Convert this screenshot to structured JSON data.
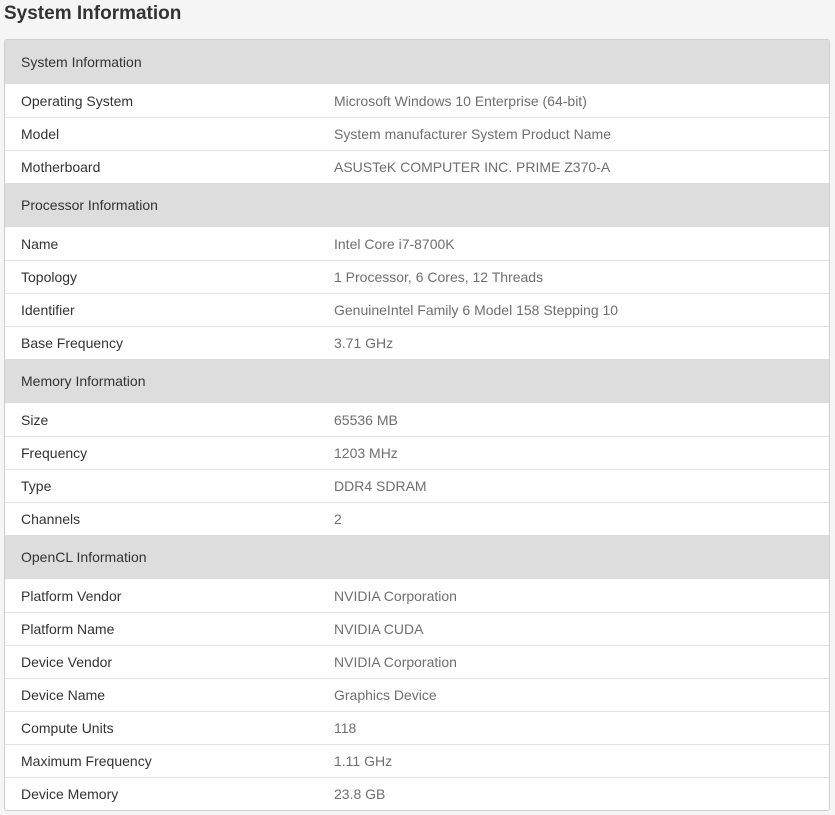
{
  "page": {
    "title": "System Information"
  },
  "sections": [
    {
      "header": "System Information",
      "rows": [
        {
          "label": "Operating System",
          "value": "Microsoft Windows 10 Enterprise (64-bit)"
        },
        {
          "label": "Model",
          "value": "System manufacturer System Product Name"
        },
        {
          "label": "Motherboard",
          "value": "ASUSTeK COMPUTER INC. PRIME Z370-A"
        }
      ]
    },
    {
      "header": "Processor Information",
      "rows": [
        {
          "label": "Name",
          "value": "Intel Core i7-8700K"
        },
        {
          "label": "Topology",
          "value": "1 Processor, 6 Cores, 12 Threads"
        },
        {
          "label": "Identifier",
          "value": "GenuineIntel Family 6 Model 158 Stepping 10"
        },
        {
          "label": "Base Frequency",
          "value": "3.71 GHz"
        }
      ]
    },
    {
      "header": "Memory Information",
      "rows": [
        {
          "label": "Size",
          "value": "65536 MB"
        },
        {
          "label": "Frequency",
          "value": "1203 MHz"
        },
        {
          "label": "Type",
          "value": "DDR4 SDRAM"
        },
        {
          "label": "Channels",
          "value": "2"
        }
      ]
    },
    {
      "header": "OpenCL Information",
      "rows": [
        {
          "label": "Platform Vendor",
          "value": "NVIDIA Corporation"
        },
        {
          "label": "Platform Name",
          "value": "NVIDIA CUDA"
        },
        {
          "label": "Device Vendor",
          "value": "NVIDIA Corporation"
        },
        {
          "label": "Device Name",
          "value": "Graphics Device"
        },
        {
          "label": "Compute Units",
          "value": "118"
        },
        {
          "label": "Maximum Frequency",
          "value": "1.11 GHz"
        },
        {
          "label": "Device Memory",
          "value": "23.8 GB"
        }
      ]
    }
  ]
}
